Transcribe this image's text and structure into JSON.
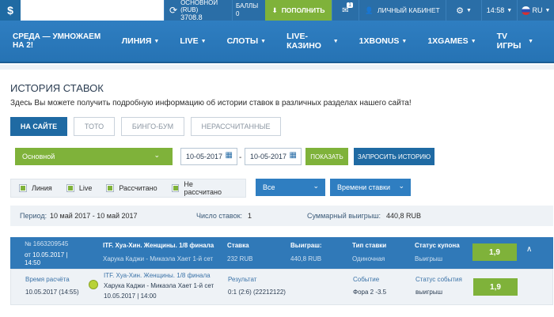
{
  "header": {
    "logo": "$",
    "balance_label": "ОСНОВНОЙ (RUB)",
    "balance_value": "3708.8",
    "points_label": "БАЛЛЫ",
    "points_value": "0",
    "deposit_label": "ПОПОЛНИТЬ",
    "mail_count": "1",
    "cabinet_label": "ЛИЧНЫЙ КАБИНЕТ",
    "time": "14:58",
    "lang": "RU"
  },
  "nav": {
    "promo": "СРЕДА — УМНОЖАЕМ НА 2!",
    "items": [
      "ЛИНИЯ",
      "LIVE",
      "СЛОТЫ",
      "LIVE-КАЗИНО",
      "1XBONUS",
      "1XGAMES",
      "TV ИГРЫ"
    ]
  },
  "page": {
    "title": "ИСТОРИЯ СТАВОК",
    "subtitle": "Здесь Вы можете получить подробную информацию об истории ставок в различных разделах нашего сайта!",
    "tabs": [
      "НА САЙТЕ",
      "ТОТО",
      "БИНГО-БУМ",
      "НЕРАССЧИТАННЫЕ"
    ]
  },
  "filters": {
    "account": "Основной",
    "date_from": "10-05-2017",
    "date_to": "10-05-2017",
    "show_label": "ПОКАЗАТЬ",
    "request_label": "ЗАПРОСИТЬ ИСТОРИЮ",
    "checkboxes": [
      "Линия",
      "Live",
      "Рассчитано",
      "Не рассчитано"
    ],
    "type_select": "Все",
    "time_select": "Времени ставки"
  },
  "summary": {
    "period_label": "Период:",
    "period_value": "10 май 2017 - 10 май 2017",
    "count_label": "Число ставок:",
    "count_value": "1",
    "win_label": "Суммарный выигрыш:",
    "win_value": "440,8 RUB"
  },
  "bet": {
    "number": "№ 1663209545",
    "date_line1": "от 10.05.2017 |",
    "date_line2": "14:50",
    "event": "ITF. Хуа-Хин. Женщины. 1/8 финала",
    "match": "Харука Каджи - Микаэла Хает 1-й сет",
    "stake_label": "Ставка",
    "stake_value": "232 RUB",
    "win_label": "Выиграш:",
    "win_value": "440,8 RUB",
    "type_label": "Тип ставки",
    "type_value": "Одиночная",
    "status_label": "Статус купона",
    "status_value": "Выигрыш",
    "coef": "1,9"
  },
  "detail": {
    "calc_label": "Время расчёта",
    "calc_value": "10.05.2017 (14:55)",
    "event": "ITF. Хуа-Хин. Женщины. 1/8 финала",
    "match": "Харука Каджи - Микаэла Хает 1-й сет",
    "match_date": "10.05.2017 | 14:00",
    "result_label": "Результат",
    "result_value": "0:1 (2:6) (22212122)",
    "event_label": "Событие",
    "event_value": "Фора 2 -3.5",
    "status_label": "Статус события",
    "status_value": "выигрыш",
    "coef": "1,9"
  }
}
